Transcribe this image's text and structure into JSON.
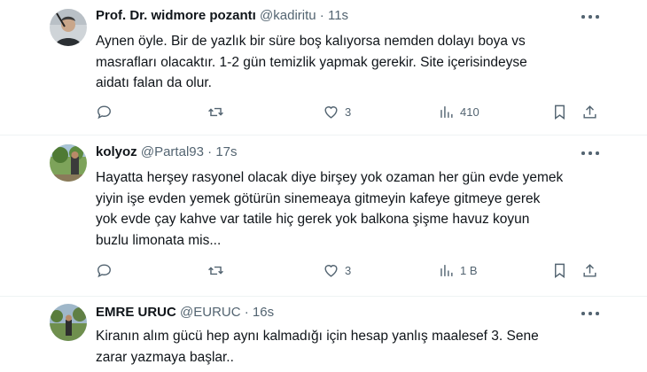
{
  "tweets": [
    {
      "name": "Prof. Dr. widmore pozantı",
      "handle": "@kadiritu",
      "time": "11s",
      "text": "Aynen öyle. Bir de yazlık bir süre boş kalıyorsa nemden dolayı boya vs\nmasrafları olacaktır. 1-2 gün temizlik yapmak gerekir. Site içerisindeyse\naidatı falan da olur.",
      "likes": "3",
      "views": "410",
      "icons": [
        "reply-icon",
        "retweet-icon",
        "like-icon",
        "views-icon",
        "bookmark-icon",
        "share-icon"
      ]
    },
    {
      "name": "kolyoz",
      "handle": "@Partal93",
      "time": "17s",
      "text": "Hayatta herşey rasyonel olacak diye birşey yok ozaman her gün evde yemek\nyiyin işe evden yemek götürün sinemeaya gitmeyin kafeye gitmeye gerek\nyok evde çay kahve var tatile hiç gerek yok balkona şişme havuz koyun\nbuzlu limonata mis...",
      "likes": "3",
      "views": "1 B"
    },
    {
      "name": "EMRE URUC",
      "handle": "@EURUC",
      "time": "16s",
      "text": "Kiranın alım gücü hep aynı kalmadığı için hesap yanlış maalesef 3. Sene\nzarar yazmaya başlar..",
      "likes": "",
      "views": ""
    }
  ],
  "dot": "·",
  "colors": {
    "text": "#0f1419",
    "secondary": "#536471",
    "divider": "#eff3f4"
  }
}
